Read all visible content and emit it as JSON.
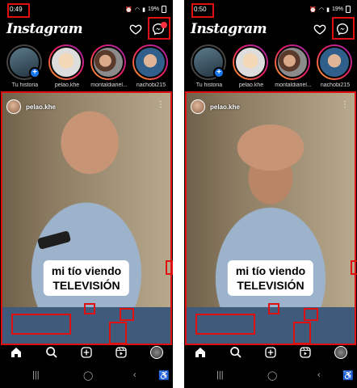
{
  "screens": [
    {
      "time": "0:49",
      "battery": "19%",
      "app_title": "Instagram",
      "messenger_badge": true,
      "stories": [
        {
          "label": "Tu historia",
          "own": true
        },
        {
          "label": "pelao.khe"
        },
        {
          "label": "montaldiariel..."
        },
        {
          "label": "nachobi215"
        }
      ],
      "post": {
        "username": "pelao.khe",
        "caption_line1": "mi tío viendo",
        "caption_line2": "TELEVISIÓN"
      }
    },
    {
      "time": "0:50",
      "battery": "19%",
      "app_title": "Instagram",
      "messenger_badge": false,
      "stories": [
        {
          "label": "Tu historia",
          "own": true
        },
        {
          "label": "pelao.khe"
        },
        {
          "label": "montaldiariel..."
        },
        {
          "label": "nachobi215"
        }
      ],
      "post": {
        "username": "pelao.khe",
        "caption_line1": "mi tío viendo",
        "caption_line2": "TELEVISIÓN"
      }
    }
  ],
  "colors": {
    "highlight": "#e01010",
    "badge": "#ff3040",
    "brand_blue": "#1877f2"
  },
  "nav_icons": [
    "home-icon",
    "search-icon",
    "create-icon",
    "reels-icon",
    "profile-avatar"
  ],
  "system_nav": [
    "recent-apps-icon",
    "home-circle-icon",
    "back-icon",
    "accessibility-icon"
  ]
}
